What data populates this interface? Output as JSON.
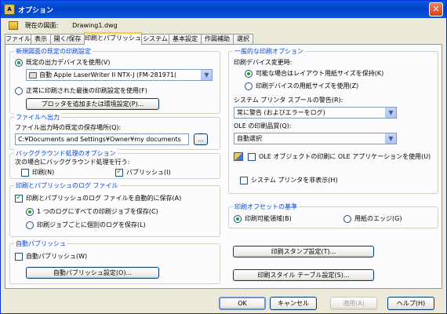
{
  "window": {
    "title": "オプション",
    "close_glyph": "✕"
  },
  "drawing": {
    "label": "現在の図面:",
    "value": "Drawing1.dwg"
  },
  "tabs": [
    {
      "label": "ファイル"
    },
    {
      "label": "表示"
    },
    {
      "label": "開く/保存"
    },
    {
      "label": "印刷とパブリッシュ"
    },
    {
      "label": "システム"
    },
    {
      "label": "基本設定"
    },
    {
      "label": "作図補助"
    },
    {
      "label": "選択"
    }
  ],
  "active_tab": "印刷とパブリッシュ",
  "new_drawing": {
    "title": "新規図面の既定の印刷設定",
    "use_default_device": "既定の出力デバイスを使用(V)",
    "device_select": "自動 Apple LaserWriter II NTX-J (FM-281971(",
    "use_last": "正常に印刷された最後の印刷設定を使用(F)",
    "plotter_button": "プロッタを追加または環境設定(P)..."
  },
  "print_to_file": {
    "title": "ファイルへ出力",
    "label": "ファイル出力時の既定の保存場所(Q):",
    "path": "C:¥Documents and Settings¥Owner¥my documents",
    "browse": "..."
  },
  "background": {
    "title": "バックグラウンド処理のオプション",
    "label": "次の場合にバックグラウンド処理を行う:",
    "plot": "印刷(N)",
    "publish": "パブリッシュ(I)"
  },
  "log": {
    "title": "印刷とパブリッシュのログ ファイル",
    "auto_save": "印刷とパブリッシュのログ ファイルを自動的に保存(A)",
    "continuous": "1 つのログにすべての印刷ジョブを保存(C)",
    "per_job": "印刷ジョブごとに個別のログを保存(L)"
  },
  "auto_publish": {
    "title": "自動パブリッシュ",
    "checkbox": "自動パブリッシュ(W)",
    "settings_button": "自動パブリッシュ設定(O)..."
  },
  "general": {
    "title": "一般的な印刷オプション",
    "device_change_label": "印刷デバイス変更時:",
    "keep_layout": "可能な場合はレイアウト用紙サイズを保持(K)",
    "use_device_paper": "印刷デバイスの用紙サイズを使用(Z)",
    "spool_label": "システム プリンタ スプールの警告(R):",
    "spool_value": "常に警告 (およびエラーをログ)",
    "ole_quality_label": "OLE の印刷品質(Q):",
    "ole_quality_value": "自動選択",
    "ole_app": "OLE オブジェクトの印刷に OLE アプリケーションを使用(U)",
    "hide_printers": "システム プリンタを非表示(H)"
  },
  "offset": {
    "title": "印刷オフセットの基準",
    "printable": "印刷可能領域(B)",
    "paper_edge": "用紙のエッジ(G)"
  },
  "right_buttons": {
    "stamp": "印刷スタンプ設定(T)...",
    "style": "印刷スタイル テーブル設定(S)..."
  },
  "footer": {
    "ok": "OK",
    "cancel": "キャンセル",
    "apply": "適用(A)",
    "help": "ヘルプ(H)"
  },
  "colors": {
    "group_title": "#0046d5",
    "title_bar": "#0a5fe0",
    "dialog_bg": "#ece9d8"
  }
}
